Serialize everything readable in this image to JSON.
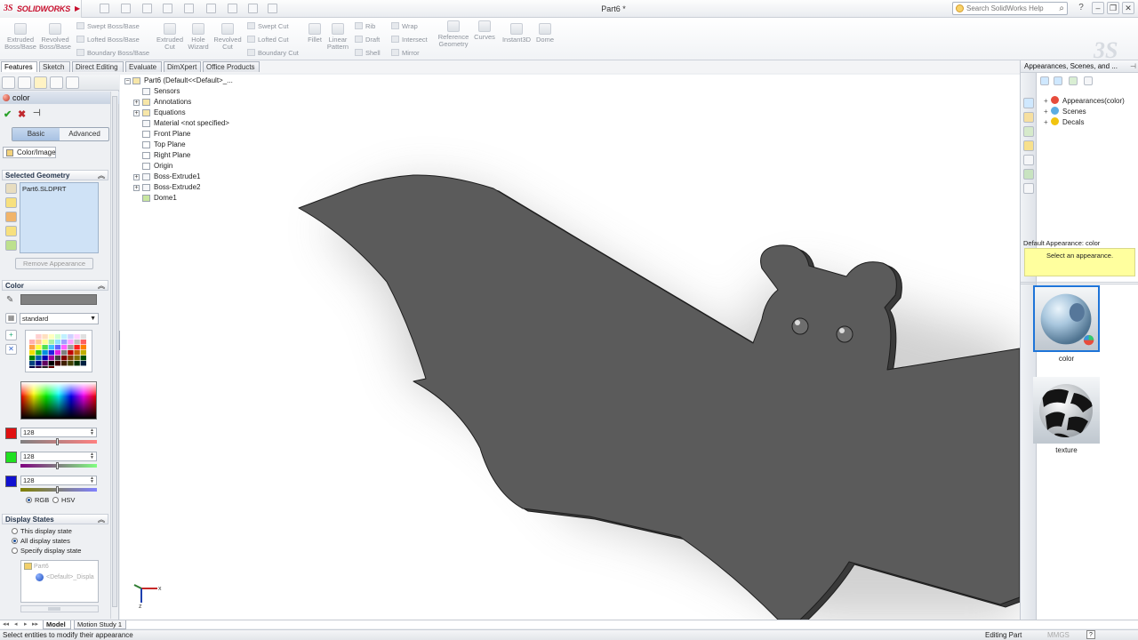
{
  "app": {
    "logo_text": "SOLIDWORKS",
    "document_title": "Part6 *",
    "search_placeholder": "Search SolidWorks Help",
    "brand_color": "#c8102e"
  },
  "command_manager": {
    "extruded_boss": "Extruded Boss/Base",
    "revolved_boss": "Revolved Boss/Base",
    "swept_boss": "Swept Boss/Base",
    "lofted_boss": "Lofted Boss/Base",
    "boundary_boss": "Boundary Boss/Base",
    "extruded_cut": "Extruded Cut",
    "hole_wizard": "Hole Wizard",
    "revolved_cut": "Revolved Cut",
    "swept_cut": "Swept Cut",
    "lofted_cut": "Lofted Cut",
    "boundary_cut": "Boundary Cut",
    "fillet": "Fillet",
    "linear_pattern": "Linear Pattern",
    "rib": "Rib",
    "draft": "Draft",
    "shell": "Shell",
    "wrap": "Wrap",
    "intersect": "Intersect",
    "mirror": "Mirror",
    "reference_geometry": "Reference Geometry",
    "curves": "Curves",
    "instant3d": "Instant3D",
    "dome": "Dome"
  },
  "tabs": [
    "Features",
    "Sketch",
    "Direct Editing",
    "Evaluate",
    "DimXpert",
    "Office Products"
  ],
  "property_manager": {
    "title": "color",
    "mode_basic": "Basic",
    "mode_advanced": "Advanced",
    "color_image_tab": "Color/Image",
    "selected_geometry_header": "Selected Geometry",
    "selected_item": "Part6.SLDPRT",
    "remove_appearance": "Remove Appearance",
    "color_header": "Color",
    "swatch_value": "#808080",
    "palette": "standard",
    "red": "128",
    "green": "128",
    "blue": "128",
    "radio_rgb": "RGB",
    "radio_hsv": "HSV",
    "display_states_header": "Display States",
    "ds_this": "This display state",
    "ds_all": "All display states",
    "ds_specify": "Specify display state",
    "ds_part": "Part6",
    "ds_default": "<Default>_Displa"
  },
  "feature_tree": {
    "root": "Part6  (Default<<Default>_...",
    "items": [
      "Sensors",
      "Annotations",
      "Equations",
      "Material <not specified>",
      "Front Plane",
      "Top Plane",
      "Right Plane",
      "Origin",
      "Boss-Extrude1",
      "Boss-Extrude2",
      "Dome1"
    ]
  },
  "model": {
    "body_color": "#5b5b5b",
    "edge_color": "#1e1e1e"
  },
  "task_pane": {
    "title": "Appearances, Scenes, and ...",
    "tree": [
      "Appearances(color)",
      "Scenes",
      "Decals"
    ],
    "default_appearance": "Default Appearance: color",
    "hint": "Select an appearance.",
    "thumbs": [
      "color",
      "texture"
    ]
  },
  "bottom_tabs": [
    "Model",
    "Motion Study 1"
  ],
  "status": {
    "message": "Select entities to modify their appearance",
    "mode": "Editing Part",
    "units": "MMGS",
    "help": "?"
  }
}
